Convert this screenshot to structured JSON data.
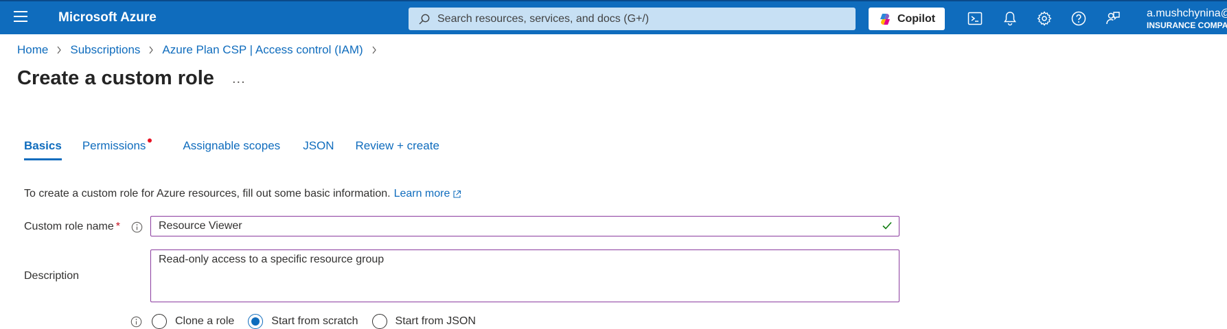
{
  "header": {
    "brand": "Microsoft Azure",
    "search_placeholder": "Search resources, services, and docs (G+/)",
    "copilot_label": "Copilot",
    "user_name": "a.mushchynina@",
    "user_org": "INSURANCE COMPA"
  },
  "icons": [
    "hamburger-icon",
    "search-icon",
    "copilot-icon",
    "cloud-shell-icon",
    "notifications-icon",
    "settings-icon",
    "help-icon",
    "feedback-icon",
    "info-icon",
    "checkmark-icon",
    "external-link-icon"
  ],
  "breadcrumb": [
    "Home",
    "Subscriptions",
    "Azure Plan CSP | Access control (IAM)"
  ],
  "page": {
    "title": "Create a custom role",
    "more": "..."
  },
  "tabs": [
    {
      "label": "Basics",
      "active": true
    },
    {
      "label": "Permissions",
      "error_dot": true
    },
    {
      "label": "Assignable scopes"
    },
    {
      "label": "JSON"
    },
    {
      "label": "Review + create"
    }
  ],
  "form": {
    "intro_text": "To create a custom role for Azure resources, fill out some basic information.",
    "learn_more": "Learn more",
    "role_name_label": "Custom role name",
    "required_marker": "*",
    "role_name_value": "Resource Viewer",
    "description_label": "Description",
    "description_value": "Read-only access to a specific resource group",
    "baseline_options": [
      {
        "label": "Clone a role",
        "selected": false
      },
      {
        "label": "Start from scratch",
        "selected": true
      },
      {
        "label": "Start from JSON",
        "selected": false
      }
    ]
  },
  "colors": {
    "topbar": "#0f6cbd",
    "link": "#0f6cbd",
    "field_border": "#8a3a9e",
    "error_dot": "#e81123",
    "valid_check": "#107c10"
  }
}
